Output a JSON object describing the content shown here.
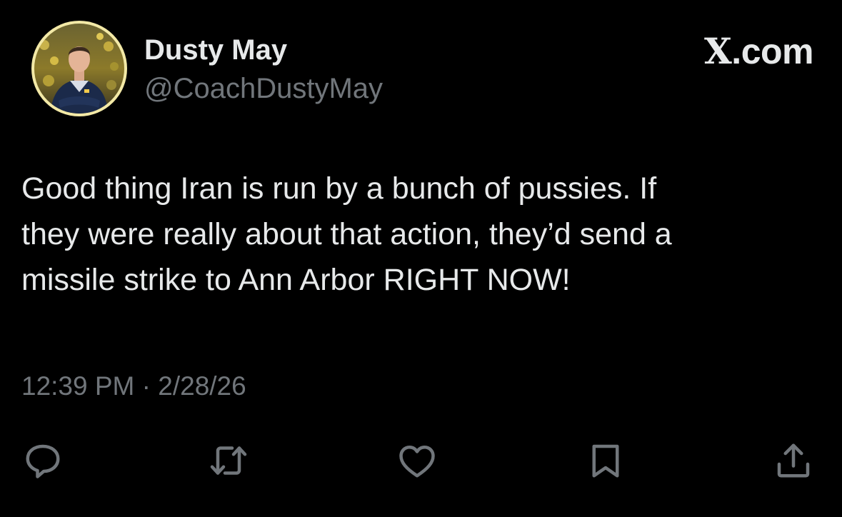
{
  "author": {
    "display_name": "Dusty May",
    "handle": "@CoachDustyMay"
  },
  "brand": {
    "logo_letter": "X",
    "suffix": ".com"
  },
  "tweet": {
    "lines": [
      "Good thing Iran is run by a bunch of pussies. If",
      "they were really about that action, they’d send a",
      "missile strike to Ann Arbor RIGHT NOW!"
    ],
    "time": "12:39 PM",
    "separator": "·",
    "date": "2/28/26"
  },
  "actions": [
    {
      "name": "reply",
      "icon": "speech-bubble-icon"
    },
    {
      "name": "repost",
      "icon": "repost-arrows-icon"
    },
    {
      "name": "like",
      "icon": "heart-icon"
    },
    {
      "name": "bookmark",
      "icon": "bookmark-icon"
    },
    {
      "name": "share",
      "icon": "share-upload-icon"
    }
  ],
  "colors": {
    "background": "#000000",
    "primary_text": "#e7e9ea",
    "secondary_text": "#71767b",
    "avatar_ring": "#f3e9a6"
  }
}
